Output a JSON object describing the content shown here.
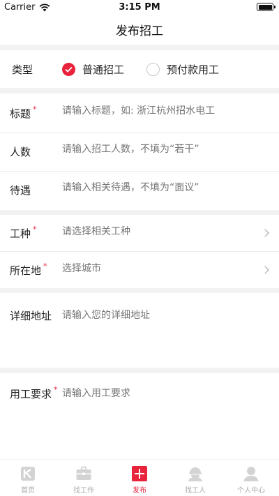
{
  "status_bar": {
    "carrier": "Carrier",
    "time": "3:15 PM"
  },
  "nav": {
    "title": "发布招工"
  },
  "type_section": {
    "label": "类型",
    "options": [
      {
        "label": "普通招工",
        "selected": true
      },
      {
        "label": "预付款用工",
        "selected": false
      }
    ]
  },
  "form": {
    "title": {
      "label": "标题",
      "required_mark": "*",
      "placeholder": "请输入标题，如: 浙江杭州招水电工"
    },
    "headcount": {
      "label": "人数",
      "placeholder": "请输入招工人数，不填为“若干”"
    },
    "salary": {
      "label": "待遇",
      "placeholder": "请输入相关待遇，不填为“面议”"
    },
    "job_type": {
      "label": "工种",
      "required_mark": "*",
      "placeholder": "请选择相关工种"
    },
    "location": {
      "label": "所在地",
      "required_mark": "*",
      "placeholder": "选择城市"
    },
    "address": {
      "label": "详细地址",
      "placeholder": "请输入您的详细地址"
    },
    "requirements": {
      "label": "用工要求",
      "required_mark": "*",
      "placeholder": "请输入用工要求"
    }
  },
  "tab_bar": {
    "tabs": [
      {
        "label": "首页",
        "icon": "home-icon"
      },
      {
        "label": "找工作",
        "icon": "briefcase-icon"
      },
      {
        "label": "发布",
        "icon": "plus-icon",
        "active": true
      },
      {
        "label": "找工人",
        "icon": "worker-icon"
      },
      {
        "label": "个人中心",
        "icon": "person-icon"
      }
    ]
  },
  "colors": {
    "accent": "#e8233b",
    "background_gap": "#f2f2f2",
    "placeholder": "#888888",
    "tab_inactive": "#a9a9a9"
  }
}
